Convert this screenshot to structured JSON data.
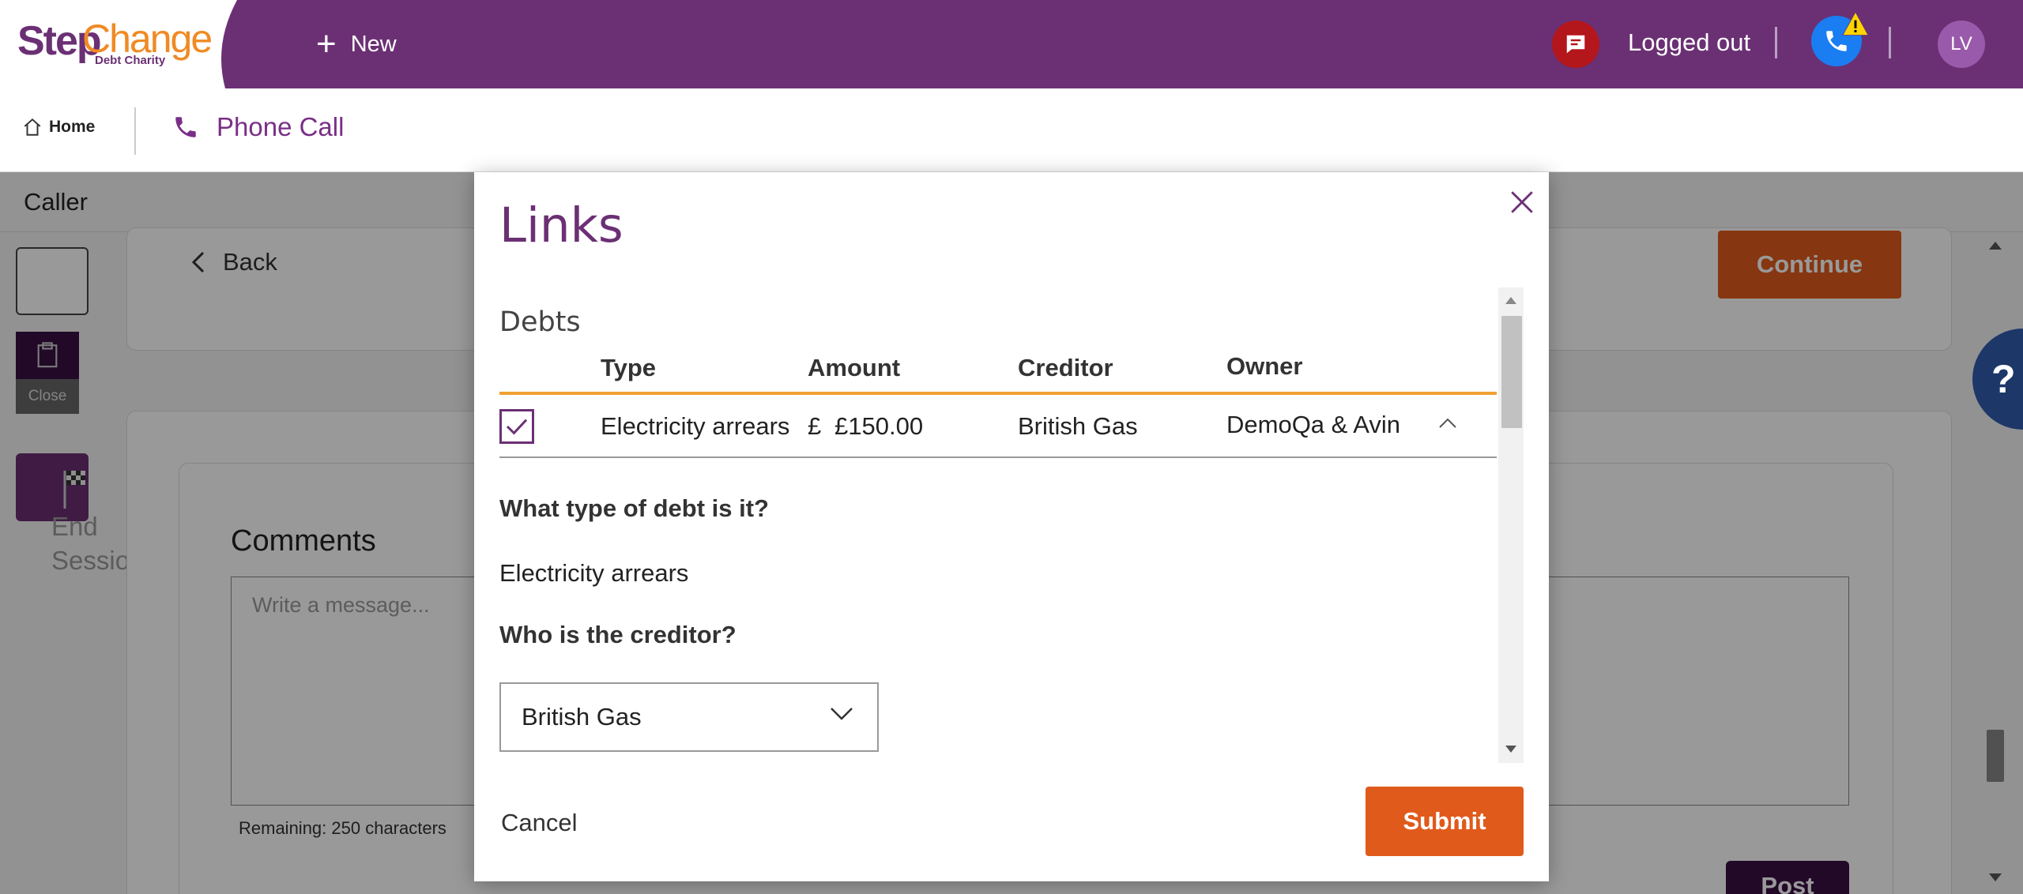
{
  "header": {
    "logo": {
      "step": "Step",
      "change": "Change",
      "sub": "Debt Charity"
    },
    "new_label": "New",
    "status": "Logged out",
    "avatar_initials": "LV",
    "colors": {
      "brand": "#6b3074",
      "accent": "#f08a24",
      "chat": "#b3161b",
      "phone": "#1a7df2"
    }
  },
  "subbar": {
    "home_label": "Home",
    "tab_label": "Phone Call"
  },
  "background": {
    "caller_label": "Caller",
    "rail_close_label": "Close",
    "rail_end_text": [
      "End",
      "Session"
    ],
    "back_label": "Back",
    "continue_label": "Continue",
    "comments_title": "Comments",
    "comments_placeholder": "Write a message...",
    "remaining": "Remaining: 250 characters",
    "post_label": "Post",
    "help_label": "?"
  },
  "modal": {
    "title": "Links",
    "section": "Debts",
    "columns": [
      "Type",
      "Amount",
      "Creditor",
      "Owner"
    ],
    "row": {
      "checked": true,
      "type": "Electricity arrears",
      "currency": "£",
      "amount": "£150.00",
      "creditor": "British Gas",
      "owner": "DemoQa & Avin"
    },
    "q1": "What type of debt is it?",
    "a1": "Electricity arrears",
    "q2": "Who is the creditor?",
    "creditor_select": "British Gas",
    "cancel_label": "Cancel",
    "submit_label": "Submit"
  }
}
